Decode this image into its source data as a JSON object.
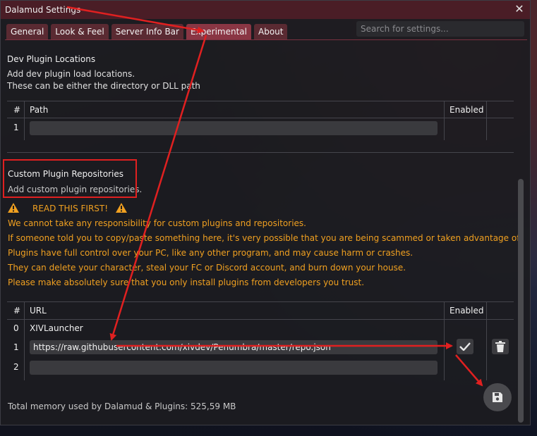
{
  "window": {
    "title": "Dalamud Settings"
  },
  "tabs": [
    {
      "label": "General"
    },
    {
      "label": "Look & Feel"
    },
    {
      "label": "Server Info Bar"
    },
    {
      "label": "Experimental",
      "active": true
    },
    {
      "label": "About"
    }
  ],
  "search": {
    "placeholder": "Search for settings..."
  },
  "dev_plugins": {
    "title": "Dev Plugin Locations",
    "desc_line1": "Add dev plugin load locations.",
    "desc_line2": "These can be either the directory or DLL path",
    "col_num": "#",
    "col_path": "Path",
    "col_enabled": "Enabled",
    "rows": [
      {
        "num": "1",
        "path": ""
      }
    ]
  },
  "custom_repos": {
    "title": "Custom Plugin Repositories",
    "desc": "Add custom plugin repositories.",
    "warning_head": "READ THIS FIRST!",
    "warnings": [
      "We cannot take any responsibility for custom plugins and repositories.",
      "If someone told you to copy/paste something here, it's very possible that you are being scammed or taken advantage of.",
      "Plugins have full control over your PC, like any other program, and may cause harm or crashes.",
      "They can delete your character, steal your FC or Discord account, and burn down your house.",
      "Please make absolutely sure that you only install plugins from developers you trust."
    ],
    "col_num": "#",
    "col_url": "URL",
    "col_enabled": "Enabled",
    "rows": [
      {
        "num": "0",
        "url": "XIVLauncher"
      },
      {
        "num": "1",
        "url": "https://raw.githubusercontent.com/xivdev/Penumbra/master/repo.json"
      },
      {
        "num": "2",
        "url": ""
      }
    ]
  },
  "footer": {
    "memory": "Total memory used by Dalamud & Plugins: 525,59 MB"
  },
  "icons": {
    "close": "close-icon",
    "warning": "warning-icon",
    "check": "check-icon",
    "trash": "trash-icon",
    "save": "save-icon"
  },
  "colors": {
    "titlebar": "#4a1d26",
    "tab": "#5a2a32",
    "tab_active": "#8a3644",
    "warning": "#f0a020",
    "annotation": "#e02020"
  }
}
